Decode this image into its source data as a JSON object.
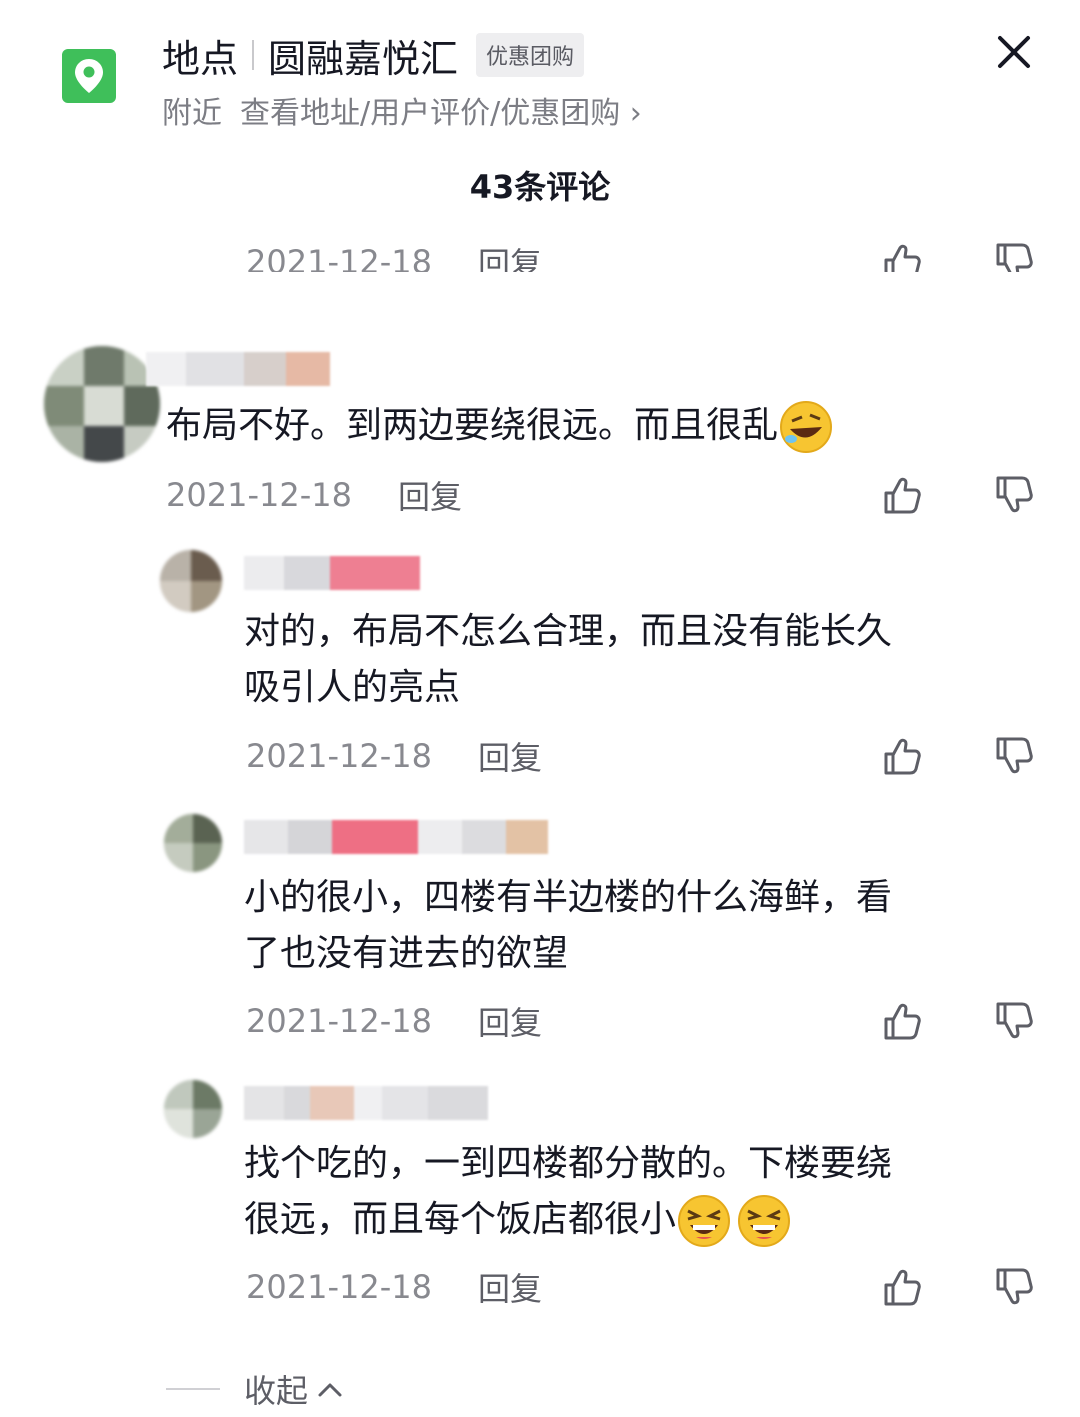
{
  "location": {
    "label": "地点",
    "name": "圆融嘉悦汇",
    "badge": "优惠团购",
    "nearby": "附近",
    "details": "查看地址/用户评价/优惠团购",
    "arrow": "›"
  },
  "header": {
    "count_title": "43条评论"
  },
  "comments": [
    {
      "date": "2021-12-18",
      "reply": "回复"
    },
    {
      "text": "布局不好。到两边要绕很远。而且很乱",
      "date": "2021-12-18",
      "reply": "回复"
    },
    {
      "text_line1": "对的，布局不怎么合理，而且没有能长久",
      "text_line2": "吸引人的亮点",
      "date": "2021-12-18",
      "reply": "回复"
    },
    {
      "text_line1": "小的很小，四楼有半边楼的什么海鲜，看",
      "text_line2": "了也没有进去的欲望",
      "date": "2021-12-18",
      "reply": "回复"
    },
    {
      "text_line1": "找个吃的，一到四楼都分散的。下楼要绕",
      "text_line2": "很远，而且每个饭店都很小",
      "date": "2021-12-18",
      "reply": "回复"
    }
  ],
  "footer": {
    "collapse": "收起",
    "collapse_icon": "chevron-up-icon"
  },
  "icons": {
    "location": "map-pin-icon",
    "close": "close-icon",
    "like": "thumbs-up-icon",
    "dislike": "thumbs-down-icon"
  },
  "colors": {
    "accent_green": "#3fbf5a",
    "text_primary": "#161823",
    "text_secondary": "#88898f"
  }
}
